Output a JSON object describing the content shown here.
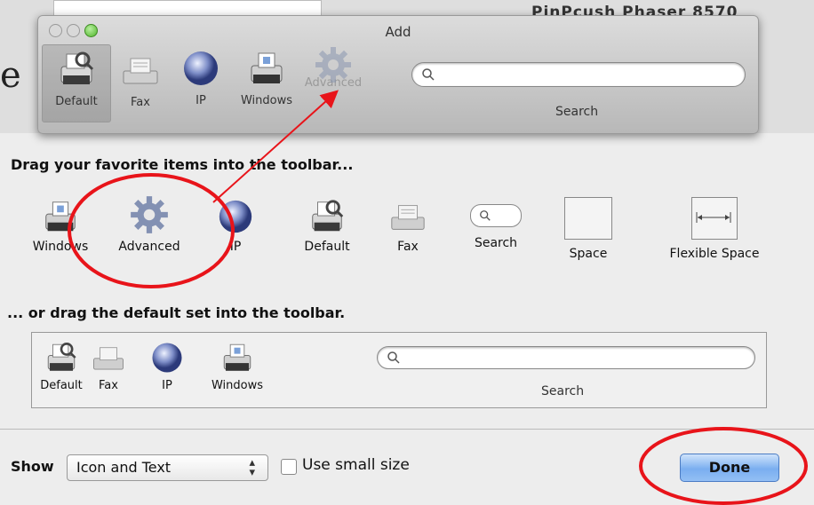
{
  "background": {
    "window_title": "PinPcush Phaser 8570"
  },
  "add_window": {
    "title": "Add",
    "toolbar": {
      "items": [
        {
          "label": "Default",
          "icon": "printer-icon",
          "selected": true
        },
        {
          "label": "Fax",
          "icon": "fax-icon"
        },
        {
          "label": "IP",
          "icon": "globe-icon"
        },
        {
          "label": "Windows",
          "icon": "windows-printer-icon"
        },
        {
          "label": "Advanced",
          "icon": "gear-icon"
        }
      ],
      "search_label": "Search"
    }
  },
  "customize": {
    "drag_items_heading": "Drag your favorite items into the toolbar...",
    "items": [
      {
        "label": "Windows",
        "icon": "windows-printer-icon"
      },
      {
        "label": "Advanced",
        "icon": "gear-icon"
      },
      {
        "label": "IP",
        "icon": "globe-icon"
      },
      {
        "label": "Default",
        "icon": "printer-icon"
      },
      {
        "label": "Fax",
        "icon": "fax-icon"
      },
      {
        "label": "Search",
        "icon": "search-field-icon"
      },
      {
        "label": "Space",
        "icon": "space-icon"
      },
      {
        "label": "Flexible Space",
        "icon": "flexible-space-icon"
      }
    ],
    "default_set_heading": "... or drag the default set into the toolbar.",
    "default_set": {
      "items": [
        {
          "label": "Default"
        },
        {
          "label": "Fax"
        },
        {
          "label": "IP"
        },
        {
          "label": "Windows"
        }
      ],
      "search_label": "Search"
    }
  },
  "footer": {
    "show_label": "Show",
    "show_value": "Icon and Text",
    "small_size_label": "Use small size",
    "small_size_checked": false,
    "done_label": "Done"
  },
  "annotation_color": "#e8141a"
}
